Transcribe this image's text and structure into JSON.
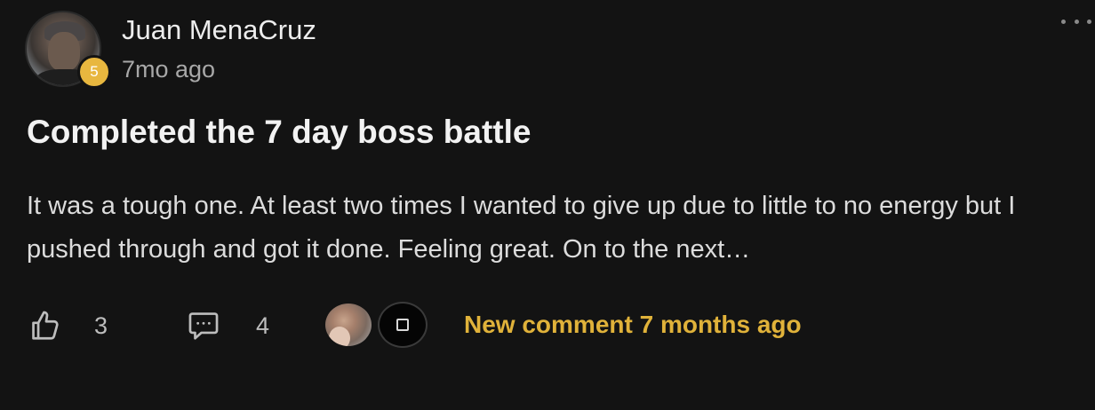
{
  "author": {
    "name": "Juan MenaCruz",
    "level": "5",
    "timestamp": "7mo ago"
  },
  "post": {
    "title": "Completed the 7 day boss battle",
    "body": "It was a tough one. At least two times I wanted to give up due to little to no energy but I pushed through and got it done. Feeling great. On to the next…"
  },
  "actions": {
    "likes": "3",
    "comments": "4",
    "new_comment": "New comment 7 months ago"
  },
  "icons": {
    "like": "thumbs-up-icon",
    "comment": "comment-bubble-icon",
    "more": "more-options-icon"
  },
  "colors": {
    "background": "#131313",
    "accent": "#e0b23a",
    "level_badge": "#e8b73f"
  }
}
